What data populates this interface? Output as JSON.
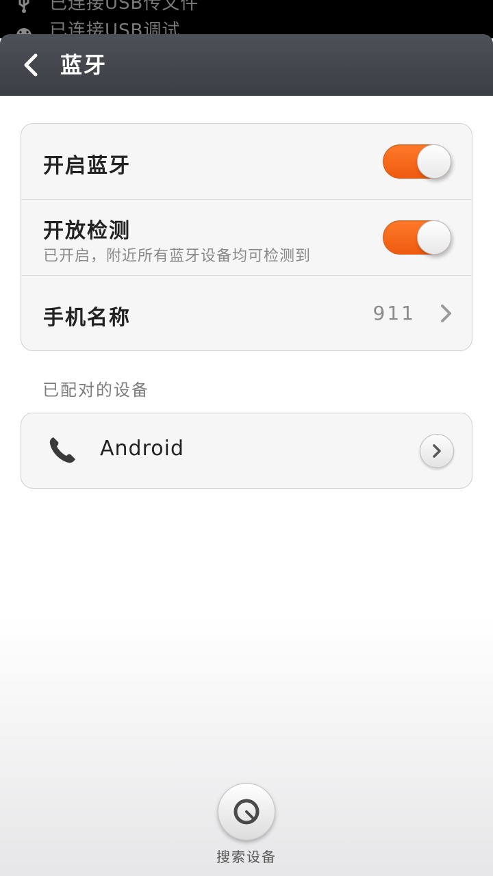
{
  "notification": {
    "line1": "已连接USB传文件",
    "line2": "已连接USB调试"
  },
  "header": {
    "title": "蓝牙"
  },
  "settings": {
    "bluetooth_toggle": {
      "label": "开启蓝牙",
      "on": true
    },
    "discoverable_toggle": {
      "label": "开放检测",
      "subtitle": "已开启，附近所有蓝牙设备均可检测到",
      "on": true
    },
    "phone_name": {
      "label": "手机名称",
      "value": "911"
    }
  },
  "paired": {
    "header": "已配对的设备",
    "devices": [
      {
        "name": "Android",
        "icon": "phone-icon"
      }
    ]
  },
  "footer": {
    "scan_label": "搜索设备"
  },
  "colors": {
    "accent": "#f0600f",
    "titlebar": "#43464c"
  }
}
